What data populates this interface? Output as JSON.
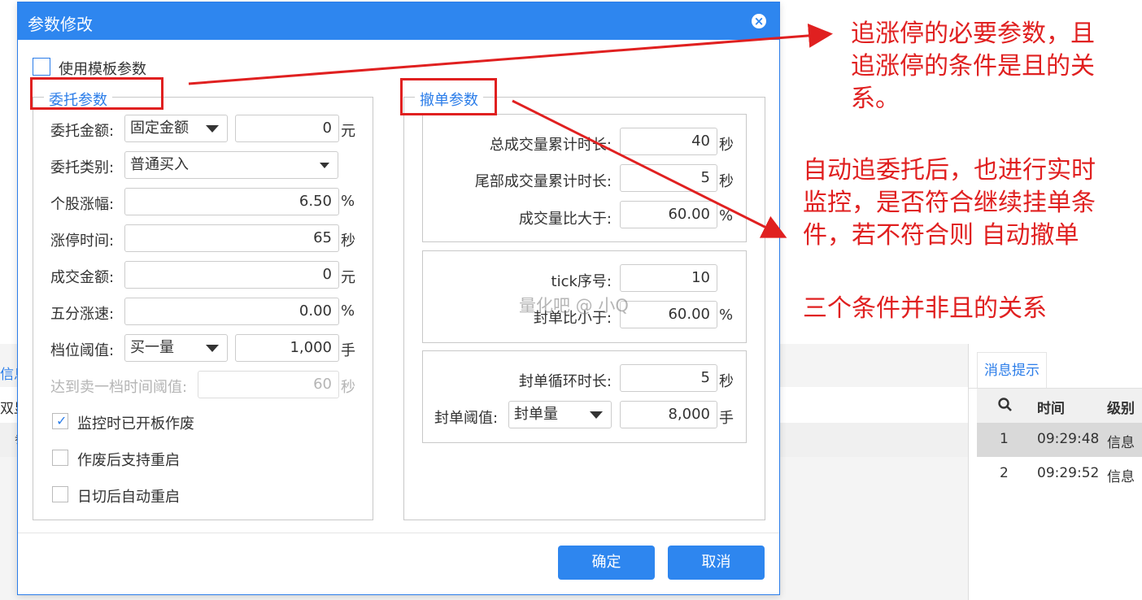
{
  "background": {
    "left_text_1": "信息",
    "left_text_2": "双显",
    "left_text_3": "参",
    "message_panel": {
      "tab_label": "消息提示",
      "search_icon": "magnifier-icon",
      "headers": {
        "time": "时间",
        "level": "级别"
      },
      "rows": [
        {
          "no": "1",
          "time": "09:29:48",
          "level": "信息"
        },
        {
          "no": "2",
          "time": "09:29:52",
          "level": "信息"
        }
      ]
    }
  },
  "dialog": {
    "title": "参数修改",
    "close_icon": "close-icon",
    "use_template_label": "使用模板参数",
    "entrust": {
      "legend": "委托参数",
      "amount_label": "委托金额:",
      "amount_type": "固定金额",
      "amount_value": "0",
      "amount_unit": "元",
      "type_label": "委托类别:",
      "type_value": "普通买入",
      "rise_label": "个股涨幅:",
      "rise_value": "6.50",
      "rise_unit": "%",
      "limit_time_label": "涨停时间:",
      "limit_time_value": "65",
      "limit_time_unit": "秒",
      "deal_amount_label": "成交金额:",
      "deal_amount_value": "0",
      "deal_amount_unit": "元",
      "five_min_label": "五分涨速:",
      "five_min_value": "0.00",
      "five_min_unit": "%",
      "level_label": "档位阈值:",
      "level_type": "买一量",
      "level_value": "1,000",
      "level_unit": "手",
      "sell1_label": "达到卖一档时间阈值:",
      "sell1_value": "60",
      "sell1_unit": "秒",
      "checkbox_1": {
        "label": "监控时已开板作废",
        "checked": true
      },
      "checkbox_2": {
        "label": "作废后支持重启",
        "checked": false
      },
      "checkbox_3": {
        "label": "日切后自动重启",
        "checked": false
      }
    },
    "cancel_params": {
      "legend": "撤单参数",
      "total_time_label": "总成交量累计时长:",
      "total_time_value": "40",
      "total_time_unit": "秒",
      "tail_time_label": "尾部成交量累计时长:",
      "tail_time_value": "5",
      "tail_time_unit": "秒",
      "ratio_label": "成交量比大于:",
      "ratio_value": "60.00",
      "ratio_unit": "%",
      "tick_label": "tick序号:",
      "tick_value": "10",
      "seal_ratio_label": "封单比小于:",
      "seal_ratio_value": "60.00",
      "seal_ratio_unit": "%",
      "seal_cycle_label": "封单循环时长:",
      "seal_cycle_value": "5",
      "seal_cycle_unit": "秒",
      "seal_threshold_label": "封单阈值:",
      "seal_threshold_type": "封单量",
      "seal_threshold_value": "8,000",
      "seal_threshold_unit": "手"
    },
    "ok_label": "确定",
    "cancel_label": "取消"
  },
  "watermark": "量化吧 @ 小Q",
  "annotations": {
    "note_1_line1": "追涨停的必要参数，且",
    "note_1_line2": "追涨停的条件是且的关",
    "note_1_line3": "系。",
    "note_2_line1": "自动追委托后，也进行实时",
    "note_2_line2": "监控，是否符合继续挂单条",
    "note_2_line3": "件，若不符合则 自动撤单",
    "note_3": "三个条件并非且的关系",
    "color": "#e02020"
  }
}
